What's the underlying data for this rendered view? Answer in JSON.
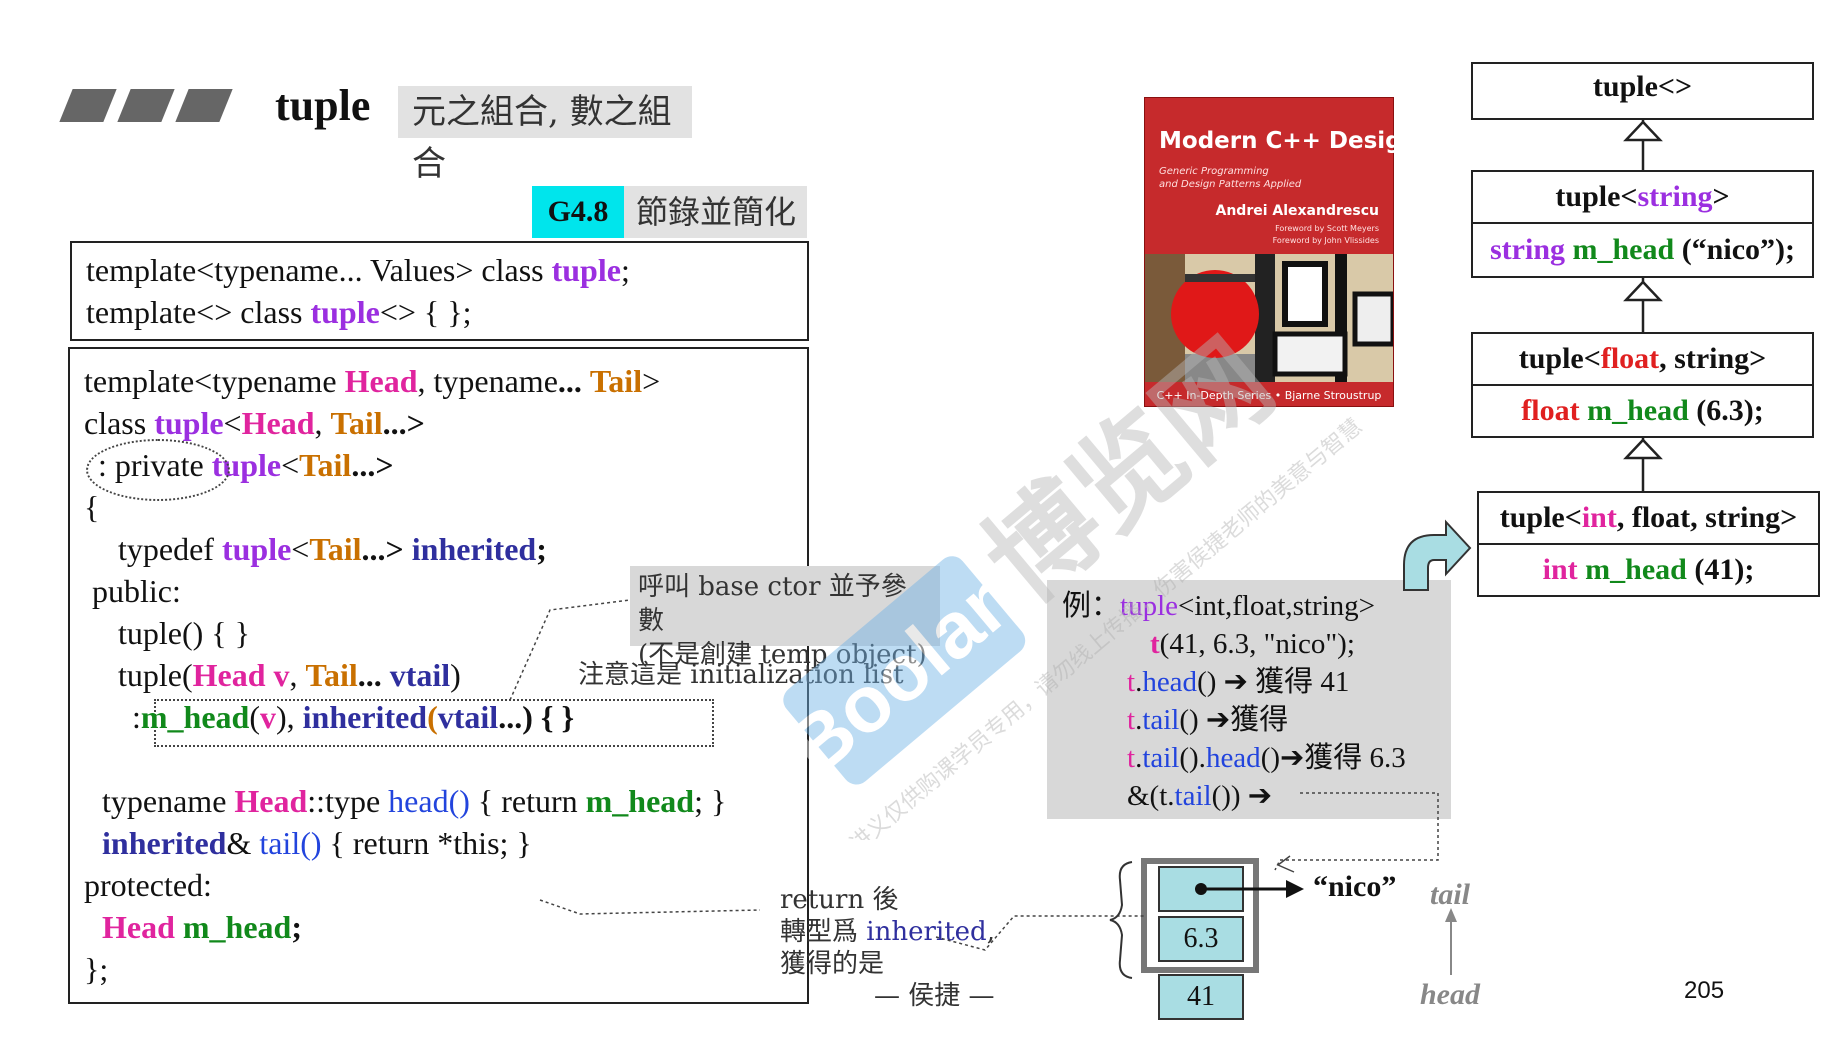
{
  "header": {
    "title": "tuple",
    "subtitle": "元之組合, 數之組合"
  },
  "section": {
    "tag": "G4.8",
    "label": "節錄並簡化"
  },
  "code_top": {
    "line1": {
      "a": "template<typename... Values> class ",
      "b": "tuple",
      "c": ";"
    },
    "line2": {
      "a": "template<> class ",
      "b": "tuple",
      "c": "<> { };"
    }
  },
  "code_main": {
    "l1": [
      "template<typename ",
      "Head",
      ", typename",
      "...",
      " ",
      "Tail",
      ">"
    ],
    "l2": [
      "class ",
      "tuple",
      "<",
      "Head",
      ", ",
      "Tail",
      "...>"
    ],
    "l3": [
      ": private ",
      "tuple",
      "<",
      "Tail",
      "...>"
    ],
    "l4": "{",
    "l5": [
      "typedef ",
      "tuple",
      "<",
      "Tail",
      "...> ",
      "inherited",
      ";"
    ],
    "l6": "public:",
    "l7": "tuple() { }",
    "l8": [
      "tuple(",
      "Head v",
      ", ",
      "Tail",
      "... ",
      "vtail",
      ")"
    ],
    "l9": [
      ":",
      "m_head",
      "(",
      "v",
      "), ",
      "inherited",
      "(",
      "vtail",
      "...) { }"
    ],
    "l10": [
      "typename ",
      "Head",
      "::type ",
      "head()",
      " { return ",
      "m_head",
      "; }"
    ],
    "l11": [
      "inherited",
      "& ",
      "tail()",
      " { return *this; }"
    ],
    "l12": "protected:",
    "l13": [
      "Head",
      " ",
      "m_head",
      ";"
    ],
    "l14": "};"
  },
  "annotations": {
    "base_ctor": "呼叫 base ctor 並予參數",
    "not_temp": "(不是創建 temp object)",
    "init_list": "注意這是 initialization list",
    "return_after1": "return 後",
    "return_after2a": "轉型爲 ",
    "return_after2b": "inherited",
    "return_after2c": ",",
    "return_after3": "獲得的是",
    "author": "— 侯捷 —"
  },
  "book": {
    "title": "Modern C++ Design",
    "subtitle1": "Generic Programming",
    "subtitle2": "and Design Patterns Applied",
    "author": "Andrei Alexandrescu",
    "foreword1": "Foreword by Scott Meyers",
    "foreword2": "Foreword by John Vlissides",
    "series": "C++ In-Depth Series • Bjarne Stroustrup"
  },
  "hierarchy": {
    "box1": "tuple<>",
    "box2_title": [
      "tuple<",
      "string",
      ">"
    ],
    "box2_member": [
      "string",
      " ",
      "m_head",
      " (“nico”);"
    ],
    "box3_title": [
      "tuple<",
      "float",
      ", string>"
    ],
    "box3_member": [
      "float",
      " ",
      "m_head",
      " (6.3);"
    ],
    "box4_title": [
      "tuple<",
      "int",
      ", float, string>"
    ],
    "box4_member": [
      "int",
      " ",
      "m_head",
      " (41);"
    ]
  },
  "example": {
    "l1": [
      "例：",
      "tuple",
      "<int,float,string>"
    ],
    "l2": [
      "t",
      "(41, 6.3, \"nico\");"
    ],
    "l3": [
      "t",
      ".",
      "head",
      "() ➔ 獲得 41"
    ],
    "l4": [
      "t",
      ".",
      "tail",
      "() ➔獲得"
    ],
    "l5": [
      "t",
      ".",
      "tail",
      "().",
      "head",
      "()➔獲得 6.3"
    ],
    "l6": [
      "&(t.",
      "tail",
      "()) ➔"
    ]
  },
  "memory": {
    "cell1": "",
    "cell2": "6.3",
    "cell3": "41",
    "nico": "“nico”",
    "tail": "tail",
    "head": "head"
  },
  "page_number": "205",
  "watermark": {
    "brand": "博览网",
    "latin": "Boolan",
    "notice1": "本讲义仅供购课学员专用，请勿线上传播，伤害侯捷老师的美意与智慧"
  }
}
